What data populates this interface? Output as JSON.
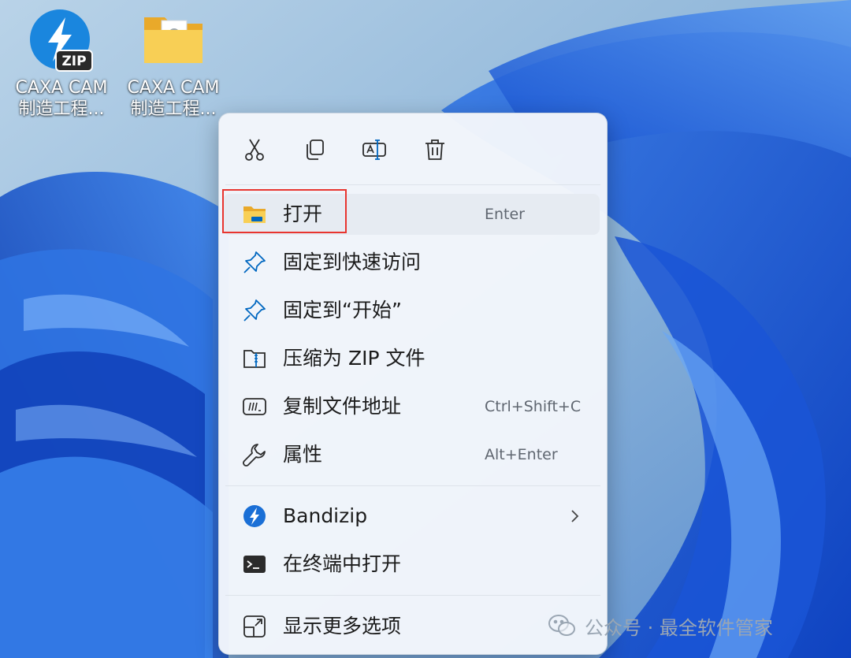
{
  "desktop": {
    "icons": [
      {
        "name_line1": "CAXA CAM",
        "name_line2": "制造工程...",
        "icon": "bandizip-zip-file-icon",
        "badge": "ZIP"
      },
      {
        "name_line1": "CAXA CAM",
        "name_line2": "制造工程...",
        "icon": "folder-icon"
      }
    ]
  },
  "context_menu": {
    "quick_actions": [
      {
        "icon": "scissors-icon",
        "action": "cut"
      },
      {
        "icon": "copy-icon",
        "action": "copy"
      },
      {
        "icon": "rename-icon",
        "action": "rename"
      },
      {
        "icon": "trash-icon",
        "action": "delete"
      }
    ],
    "items": [
      {
        "label": "打开",
        "shortcut": "Enter",
        "icon": "folder-open-icon",
        "hovered": true
      },
      {
        "label": "固定到快速访问",
        "shortcut": "",
        "icon": "pin-icon"
      },
      {
        "label": "固定到“开始”",
        "shortcut": "",
        "icon": "pin-icon"
      },
      {
        "label": "压缩为 ZIP 文件",
        "shortcut": "",
        "icon": "zip-folder-icon"
      },
      {
        "label": "复制文件地址",
        "shortcut": "Ctrl+Shift+C",
        "icon": "path-icon"
      },
      {
        "label": "属性",
        "shortcut": "Alt+Enter",
        "icon": "wrench-icon"
      },
      {
        "label": "Bandizip",
        "shortcut": "",
        "icon": "bandizip-icon",
        "submenu": true
      },
      {
        "label": "在终端中打开",
        "shortcut": "",
        "icon": "terminal-icon"
      },
      {
        "label": "显示更多选项",
        "shortcut": "",
        "icon": "show-more-icon"
      }
    ]
  },
  "annotation": {
    "highlight_color": "#e8352f",
    "target": "打开"
  },
  "watermark": {
    "text": "公众号 · 最全软件管家",
    "icon": "wechat-icon"
  },
  "colors": {
    "accent": "#0067c0",
    "menu_bg": "#f3f6fb",
    "hover_bg": "#e6ebf2",
    "folder": "#f5c242"
  }
}
